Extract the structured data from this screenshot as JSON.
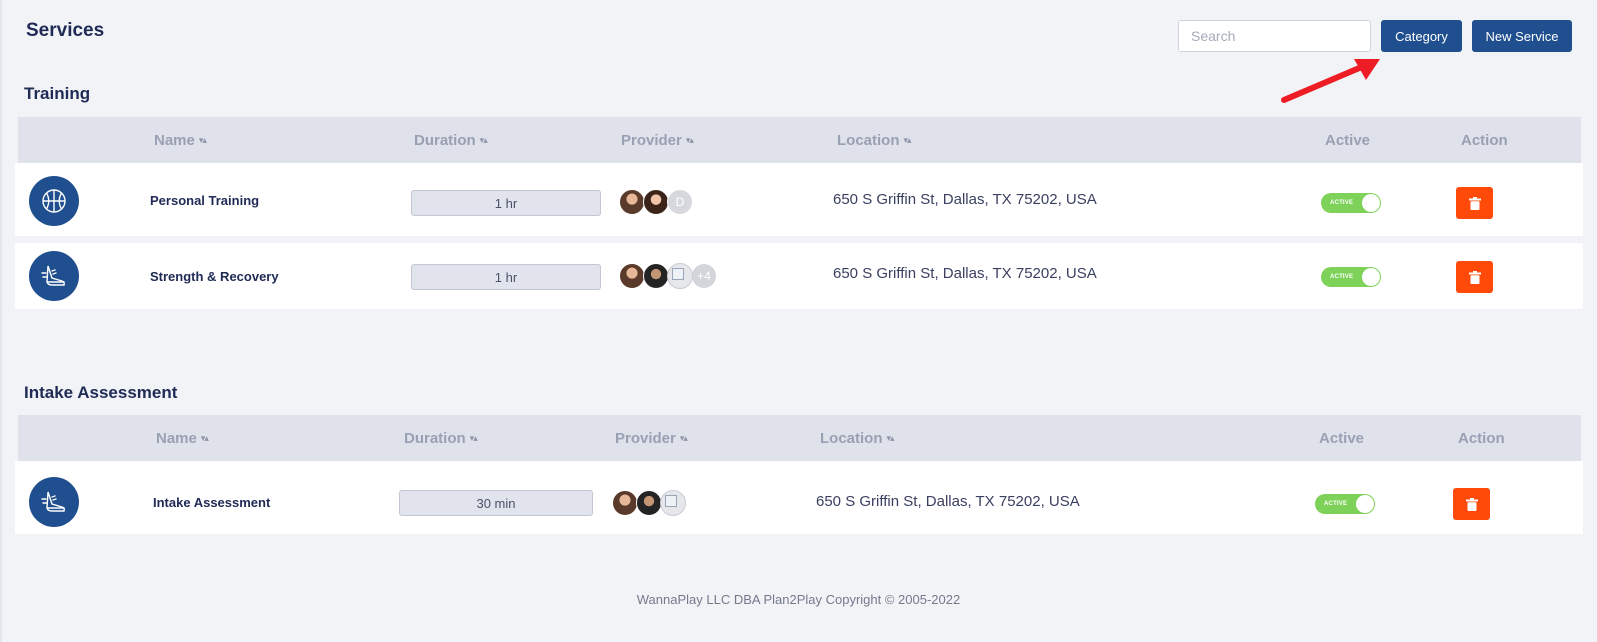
{
  "page": {
    "title": "Services"
  },
  "toolbar": {
    "search_placeholder": "Search",
    "category_label": "Category",
    "new_service_label": "New Service"
  },
  "columns": {
    "name": "Name",
    "duration": "Duration",
    "provider": "Provider",
    "location": "Location",
    "active": "Active",
    "action": "Action"
  },
  "sections": [
    {
      "title": "Training",
      "rows": [
        {
          "icon": "basketball-icon",
          "name": "Personal Training",
          "duration": "1 hr",
          "providers": [
            "photo",
            "photo",
            "D"
          ],
          "location": "650 S Griffin St, Dallas, TX 75202, USA",
          "status": "ACTIVE"
        },
        {
          "icon": "running-shoe-icon",
          "name": "Strength & Recovery",
          "duration": "1 hr",
          "providers": [
            "photo",
            "photo",
            "broken-image",
            "+4"
          ],
          "location": "650 S Griffin St, Dallas, TX 75202, USA",
          "status": "ACTIVE"
        }
      ]
    },
    {
      "title": "Intake Assessment",
      "rows": [
        {
          "icon": "running-shoe-icon",
          "name": "Intake Assessment",
          "duration": "30 min",
          "providers": [
            "photo",
            "photo",
            "broken-image"
          ],
          "location": "650 S Griffin St, Dallas, TX 75202, USA",
          "status": "ACTIVE"
        }
      ]
    }
  ],
  "footer": {
    "text": "WannaPlay LLC DBA Plan2Play Copyright © 2005-2022"
  },
  "colors": {
    "primary": "#1f4f8f",
    "active_toggle": "#7ed159",
    "delete": "#ff4a0a",
    "annotation_arrow": "#ee1c24"
  }
}
